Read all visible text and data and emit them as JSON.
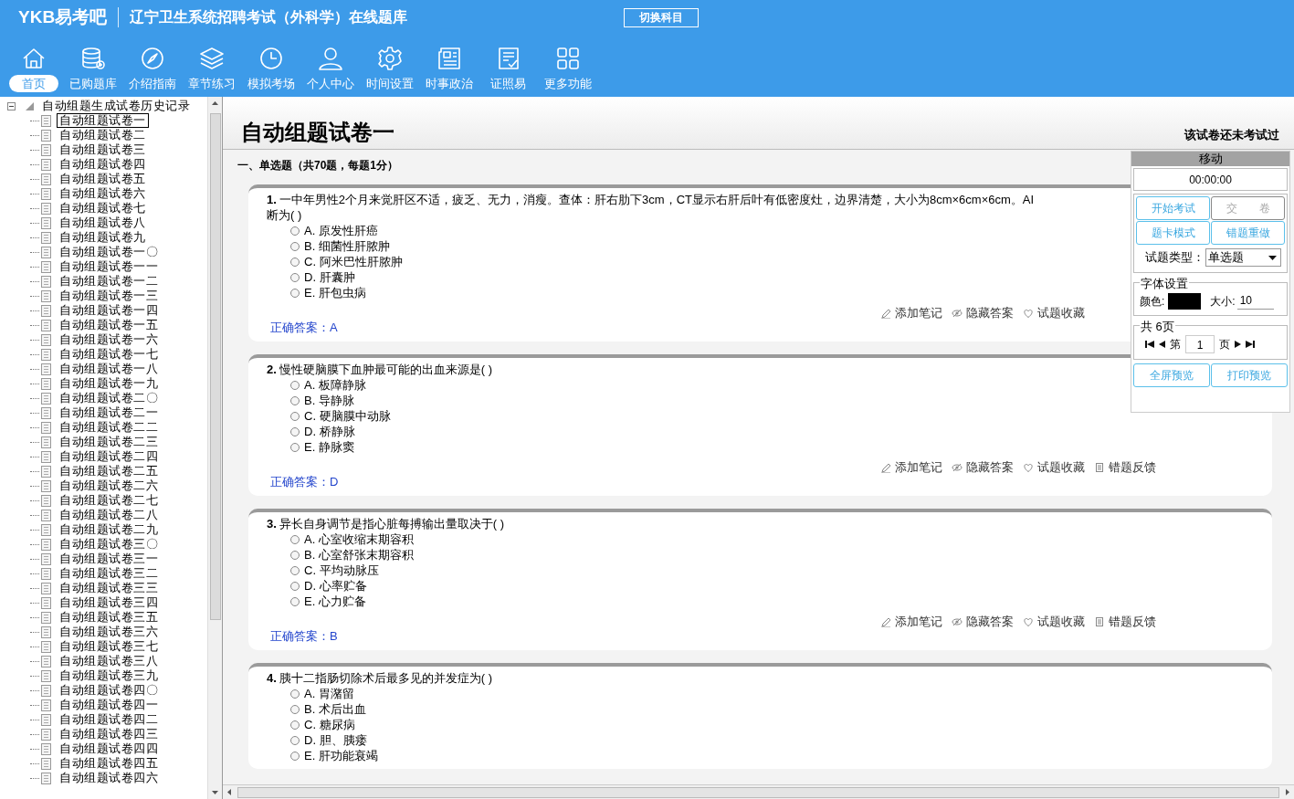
{
  "header": {
    "brand": "YKB易考吧",
    "title": "辽宁卫生系统招聘考试（外科学）在线题库",
    "switch_button": "切换科目"
  },
  "nav": [
    {
      "label": "首页",
      "selected": true
    },
    {
      "label": "已购题库",
      "selected": false
    },
    {
      "label": "介绍指南",
      "selected": false
    },
    {
      "label": "章节练习",
      "selected": false
    },
    {
      "label": "模拟考场",
      "selected": false
    },
    {
      "label": "个人中心",
      "selected": false
    },
    {
      "label": "时间设置",
      "selected": false
    },
    {
      "label": "时事政治",
      "selected": false
    },
    {
      "label": "证照易",
      "selected": false
    },
    {
      "label": "更多功能",
      "selected": false
    }
  ],
  "tree": {
    "root": "自动组题生成试卷历史记录",
    "expanded": true,
    "children": [
      {
        "label": "自动组题试卷一",
        "selected": true
      },
      {
        "label": "自动组题试卷二",
        "selected": false
      },
      {
        "label": "自动组题试卷三",
        "selected": false
      },
      {
        "label": "自动组题试卷四",
        "selected": false
      },
      {
        "label": "自动组题试卷五",
        "selected": false
      },
      {
        "label": "自动组题试卷六",
        "selected": false
      },
      {
        "label": "自动组题试卷七",
        "selected": false
      },
      {
        "label": "自动组题试卷八",
        "selected": false
      },
      {
        "label": "自动组题试卷九",
        "selected": false
      },
      {
        "label": "自动组题试卷一〇",
        "selected": false
      },
      {
        "label": "自动组题试卷一一",
        "selected": false
      },
      {
        "label": "自动组题试卷一二",
        "selected": false
      },
      {
        "label": "自动组题试卷一三",
        "selected": false
      },
      {
        "label": "自动组题试卷一四",
        "selected": false
      },
      {
        "label": "自动组题试卷一五",
        "selected": false
      },
      {
        "label": "自动组题试卷一六",
        "selected": false
      },
      {
        "label": "自动组题试卷一七",
        "selected": false
      },
      {
        "label": "自动组题试卷一八",
        "selected": false
      },
      {
        "label": "自动组题试卷一九",
        "selected": false
      },
      {
        "label": "自动组题试卷二〇",
        "selected": false
      },
      {
        "label": "自动组题试卷二一",
        "selected": false
      },
      {
        "label": "自动组题试卷二二",
        "selected": false
      },
      {
        "label": "自动组题试卷二三",
        "selected": false
      },
      {
        "label": "自动组题试卷二四",
        "selected": false
      },
      {
        "label": "自动组题试卷二五",
        "selected": false
      },
      {
        "label": "自动组题试卷二六",
        "selected": false
      },
      {
        "label": "自动组题试卷二七",
        "selected": false
      },
      {
        "label": "自动组题试卷二八",
        "selected": false
      },
      {
        "label": "自动组题试卷二九",
        "selected": false
      },
      {
        "label": "自动组题试卷三〇",
        "selected": false
      },
      {
        "label": "自动组题试卷三一",
        "selected": false
      },
      {
        "label": "自动组题试卷三二",
        "selected": false
      },
      {
        "label": "自动组题试卷三三",
        "selected": false
      },
      {
        "label": "自动组题试卷三四",
        "selected": false
      },
      {
        "label": "自动组题试卷三五",
        "selected": false
      },
      {
        "label": "自动组题试卷三六",
        "selected": false
      },
      {
        "label": "自动组题试卷三七",
        "selected": false
      },
      {
        "label": "自动组题试卷三八",
        "selected": false
      },
      {
        "label": "自动组题试卷三九",
        "selected": false
      },
      {
        "label": "自动组题试卷四〇",
        "selected": false
      },
      {
        "label": "自动组题试卷四一",
        "selected": false
      },
      {
        "label": "自动组题试卷四二",
        "selected": false
      },
      {
        "label": "自动组题试卷四三",
        "selected": false
      },
      {
        "label": "自动组题试卷四四",
        "selected": false
      },
      {
        "label": "自动组题试卷四五",
        "selected": false
      },
      {
        "label": "自动组题试卷四六",
        "selected": false
      }
    ]
  },
  "paper": {
    "title": "自动组题试卷一",
    "status": "该试卷还未考试过",
    "section": "一、单选题（共70题，每题1分）"
  },
  "questions": [
    {
      "number": "1.",
      "lines": [
        "一中年男性2个月来觉肝区不适，疲乏、无力，消瘦。查体：肝右肋下3cm，CT显示右肝后叶有低密度灶，边界清楚，大小为8cm×6cm×6cm。AI",
        "断为( )"
      ],
      "options": [
        {
          "label": "A. 原发性肝癌",
          "selected": false
        },
        {
          "label": "B. 细菌性肝脓肿",
          "selected": false
        },
        {
          "label": "C. 阿米巴性肝脓肿",
          "selected": false
        },
        {
          "label": "D. 肝囊肿",
          "selected": false
        },
        {
          "label": "E. 肝包虫病",
          "selected": false
        }
      ],
      "actions": [
        "添加笔记",
        "隐藏答案",
        "试题收藏"
      ],
      "answer": "正确答案：A"
    },
    {
      "number": "2.",
      "lines": [
        "慢性硬脑膜下血肿最可能的出血来源是( )"
      ],
      "options": [
        {
          "label": "A. 板障静脉",
          "selected": false
        },
        {
          "label": "B. 导静脉",
          "selected": false
        },
        {
          "label": "C. 硬脑膜中动脉",
          "selected": false
        },
        {
          "label": "D. 桥静脉",
          "selected": false
        },
        {
          "label": "E. 静脉窦",
          "selected": false
        }
      ],
      "actions": [
        "添加笔记",
        "隐藏答案",
        "试题收藏",
        "错题反馈"
      ],
      "answer": "正确答案：D"
    },
    {
      "number": "3.",
      "lines": [
        "异长自身调节是指心脏每搏输出量取决于( )"
      ],
      "options": [
        {
          "label": "A. 心室收缩末期容积",
          "selected": false
        },
        {
          "label": "B. 心室舒张末期容积",
          "selected": false
        },
        {
          "label": "C. 平均动脉压",
          "selected": false
        },
        {
          "label": "D. 心率贮备",
          "selected": false
        },
        {
          "label": "E. 心力贮备",
          "selected": false
        }
      ],
      "actions": [
        "添加笔记",
        "隐藏答案",
        "试题收藏",
        "错题反馈"
      ],
      "answer": "正确答案：B"
    },
    {
      "number": "4.",
      "lines": [
        "胰十二指肠切除术后最多见的并发症为( )"
      ],
      "options": [
        {
          "label": "A. 胃潴留",
          "selected": false
        },
        {
          "label": "B. 术后出血",
          "selected": false
        },
        {
          "label": "C. 糖尿病",
          "selected": false
        },
        {
          "label": "D. 胆、胰瘘",
          "selected": false
        },
        {
          "label": "E. 肝功能衰竭",
          "selected": false
        }
      ]
    }
  ],
  "panel": {
    "title": "移动",
    "timer": "00:00:00",
    "buttons": [
      {
        "label": "开始考试",
        "disabled": false
      },
      {
        "label": "交　　卷",
        "disabled": true
      },
      {
        "label": "题卡模式",
        "disabled": false
      },
      {
        "label": "错题重做",
        "disabled": false
      }
    ],
    "type_label": "试题类型：",
    "type_value": "单选题",
    "font_group": "字体设置",
    "color_label": "颜色:",
    "size_label": "大小:",
    "size_value": "10",
    "pages_group": "共 6页",
    "page_prefix": "第",
    "page_value": "1",
    "page_suffix": "页",
    "preview_buttons": [
      "全屏预览",
      "打印预览"
    ]
  }
}
